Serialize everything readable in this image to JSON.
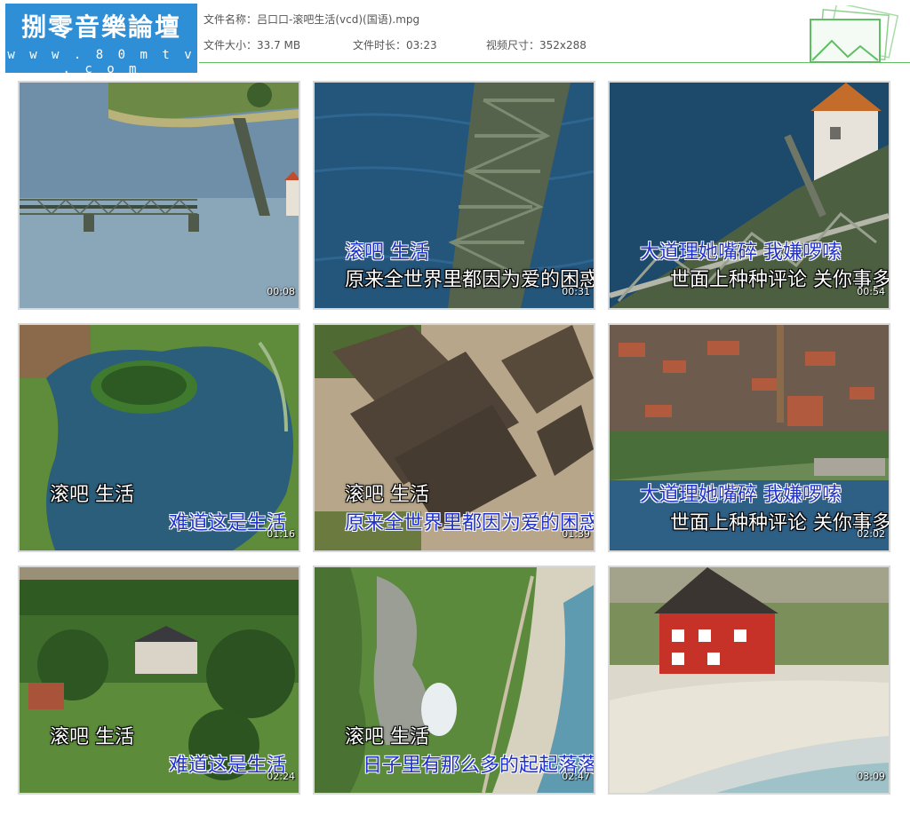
{
  "logo": {
    "title": "捌零音樂論壇",
    "url": "w w w . 8 0 m t v . c o m"
  },
  "file": {
    "name_label": "文件名称：",
    "name_value": "吕口口-滚吧生活(vcd)(国语).mpg",
    "size_label": "文件大小：",
    "size_value": "33.7 MB",
    "duration_label": "文件时长：",
    "duration_value": "03:23",
    "dims_label": "视频尺寸：",
    "dims_value": "352x288"
  },
  "thumbnails": [
    {
      "time": "00:08",
      "lyrics": []
    },
    {
      "time": "00:31",
      "lyrics": [
        "滚吧 生活",
        "原来全世界里都因为爱的困惑"
      ]
    },
    {
      "time": "00:54",
      "lyrics": [
        "大道理她嘴碎 我嫌啰嗦",
        "世面上种种评论 关你事多"
      ]
    },
    {
      "time": "01:16",
      "lyrics": [
        "滚吧 生活",
        "难道这是生活"
      ]
    },
    {
      "time": "01:39",
      "lyrics": [
        "滚吧 生活",
        "原来全世界里都因为爱的困惑"
      ]
    },
    {
      "time": "02:02",
      "lyrics": [
        "大道理她嘴碎 我嫌啰嗦",
        "世面上种种评论 关你事多"
      ]
    },
    {
      "time": "02:24",
      "lyrics": [
        "滚吧 生活",
        "难道这是生活"
      ]
    },
    {
      "time": "02:47",
      "lyrics": [
        "滚吧 生活",
        "日子里有那么多的起起落落"
      ]
    },
    {
      "time": "03:09",
      "lyrics": []
    }
  ],
  "colors": {
    "accent_line": "#5dbf62",
    "logo_bg": "#2f8fd6",
    "lyric_blue": "#2232c8"
  }
}
